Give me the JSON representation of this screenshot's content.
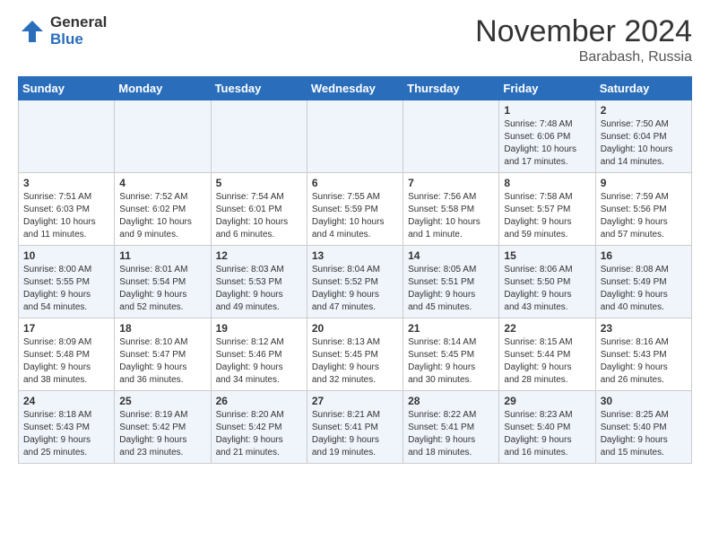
{
  "logo": {
    "general": "General",
    "blue": "Blue"
  },
  "title": "November 2024",
  "location": "Barabash, Russia",
  "days_of_week": [
    "Sunday",
    "Monday",
    "Tuesday",
    "Wednesday",
    "Thursday",
    "Friday",
    "Saturday"
  ],
  "weeks": [
    [
      {
        "day": "",
        "info": ""
      },
      {
        "day": "",
        "info": ""
      },
      {
        "day": "",
        "info": ""
      },
      {
        "day": "",
        "info": ""
      },
      {
        "day": "",
        "info": ""
      },
      {
        "day": "1",
        "info": "Sunrise: 7:48 AM\nSunset: 6:06 PM\nDaylight: 10 hours\nand 17 minutes."
      },
      {
        "day": "2",
        "info": "Sunrise: 7:50 AM\nSunset: 6:04 PM\nDaylight: 10 hours\nand 14 minutes."
      }
    ],
    [
      {
        "day": "3",
        "info": "Sunrise: 7:51 AM\nSunset: 6:03 PM\nDaylight: 10 hours\nand 11 minutes."
      },
      {
        "day": "4",
        "info": "Sunrise: 7:52 AM\nSunset: 6:02 PM\nDaylight: 10 hours\nand 9 minutes."
      },
      {
        "day": "5",
        "info": "Sunrise: 7:54 AM\nSunset: 6:01 PM\nDaylight: 10 hours\nand 6 minutes."
      },
      {
        "day": "6",
        "info": "Sunrise: 7:55 AM\nSunset: 5:59 PM\nDaylight: 10 hours\nand 4 minutes."
      },
      {
        "day": "7",
        "info": "Sunrise: 7:56 AM\nSunset: 5:58 PM\nDaylight: 10 hours\nand 1 minute."
      },
      {
        "day": "8",
        "info": "Sunrise: 7:58 AM\nSunset: 5:57 PM\nDaylight: 9 hours\nand 59 minutes."
      },
      {
        "day": "9",
        "info": "Sunrise: 7:59 AM\nSunset: 5:56 PM\nDaylight: 9 hours\nand 57 minutes."
      }
    ],
    [
      {
        "day": "10",
        "info": "Sunrise: 8:00 AM\nSunset: 5:55 PM\nDaylight: 9 hours\nand 54 minutes."
      },
      {
        "day": "11",
        "info": "Sunrise: 8:01 AM\nSunset: 5:54 PM\nDaylight: 9 hours\nand 52 minutes."
      },
      {
        "day": "12",
        "info": "Sunrise: 8:03 AM\nSunset: 5:53 PM\nDaylight: 9 hours\nand 49 minutes."
      },
      {
        "day": "13",
        "info": "Sunrise: 8:04 AM\nSunset: 5:52 PM\nDaylight: 9 hours\nand 47 minutes."
      },
      {
        "day": "14",
        "info": "Sunrise: 8:05 AM\nSunset: 5:51 PM\nDaylight: 9 hours\nand 45 minutes."
      },
      {
        "day": "15",
        "info": "Sunrise: 8:06 AM\nSunset: 5:50 PM\nDaylight: 9 hours\nand 43 minutes."
      },
      {
        "day": "16",
        "info": "Sunrise: 8:08 AM\nSunset: 5:49 PM\nDaylight: 9 hours\nand 40 minutes."
      }
    ],
    [
      {
        "day": "17",
        "info": "Sunrise: 8:09 AM\nSunset: 5:48 PM\nDaylight: 9 hours\nand 38 minutes."
      },
      {
        "day": "18",
        "info": "Sunrise: 8:10 AM\nSunset: 5:47 PM\nDaylight: 9 hours\nand 36 minutes."
      },
      {
        "day": "19",
        "info": "Sunrise: 8:12 AM\nSunset: 5:46 PM\nDaylight: 9 hours\nand 34 minutes."
      },
      {
        "day": "20",
        "info": "Sunrise: 8:13 AM\nSunset: 5:45 PM\nDaylight: 9 hours\nand 32 minutes."
      },
      {
        "day": "21",
        "info": "Sunrise: 8:14 AM\nSunset: 5:45 PM\nDaylight: 9 hours\nand 30 minutes."
      },
      {
        "day": "22",
        "info": "Sunrise: 8:15 AM\nSunset: 5:44 PM\nDaylight: 9 hours\nand 28 minutes."
      },
      {
        "day": "23",
        "info": "Sunrise: 8:16 AM\nSunset: 5:43 PM\nDaylight: 9 hours\nand 26 minutes."
      }
    ],
    [
      {
        "day": "24",
        "info": "Sunrise: 8:18 AM\nSunset: 5:43 PM\nDaylight: 9 hours\nand 25 minutes."
      },
      {
        "day": "25",
        "info": "Sunrise: 8:19 AM\nSunset: 5:42 PM\nDaylight: 9 hours\nand 23 minutes."
      },
      {
        "day": "26",
        "info": "Sunrise: 8:20 AM\nSunset: 5:42 PM\nDaylight: 9 hours\nand 21 minutes."
      },
      {
        "day": "27",
        "info": "Sunrise: 8:21 AM\nSunset: 5:41 PM\nDaylight: 9 hours\nand 19 minutes."
      },
      {
        "day": "28",
        "info": "Sunrise: 8:22 AM\nSunset: 5:41 PM\nDaylight: 9 hours\nand 18 minutes."
      },
      {
        "day": "29",
        "info": "Sunrise: 8:23 AM\nSunset: 5:40 PM\nDaylight: 9 hours\nand 16 minutes."
      },
      {
        "day": "30",
        "info": "Sunrise: 8:25 AM\nSunset: 5:40 PM\nDaylight: 9 hours\nand 15 minutes."
      }
    ]
  ]
}
